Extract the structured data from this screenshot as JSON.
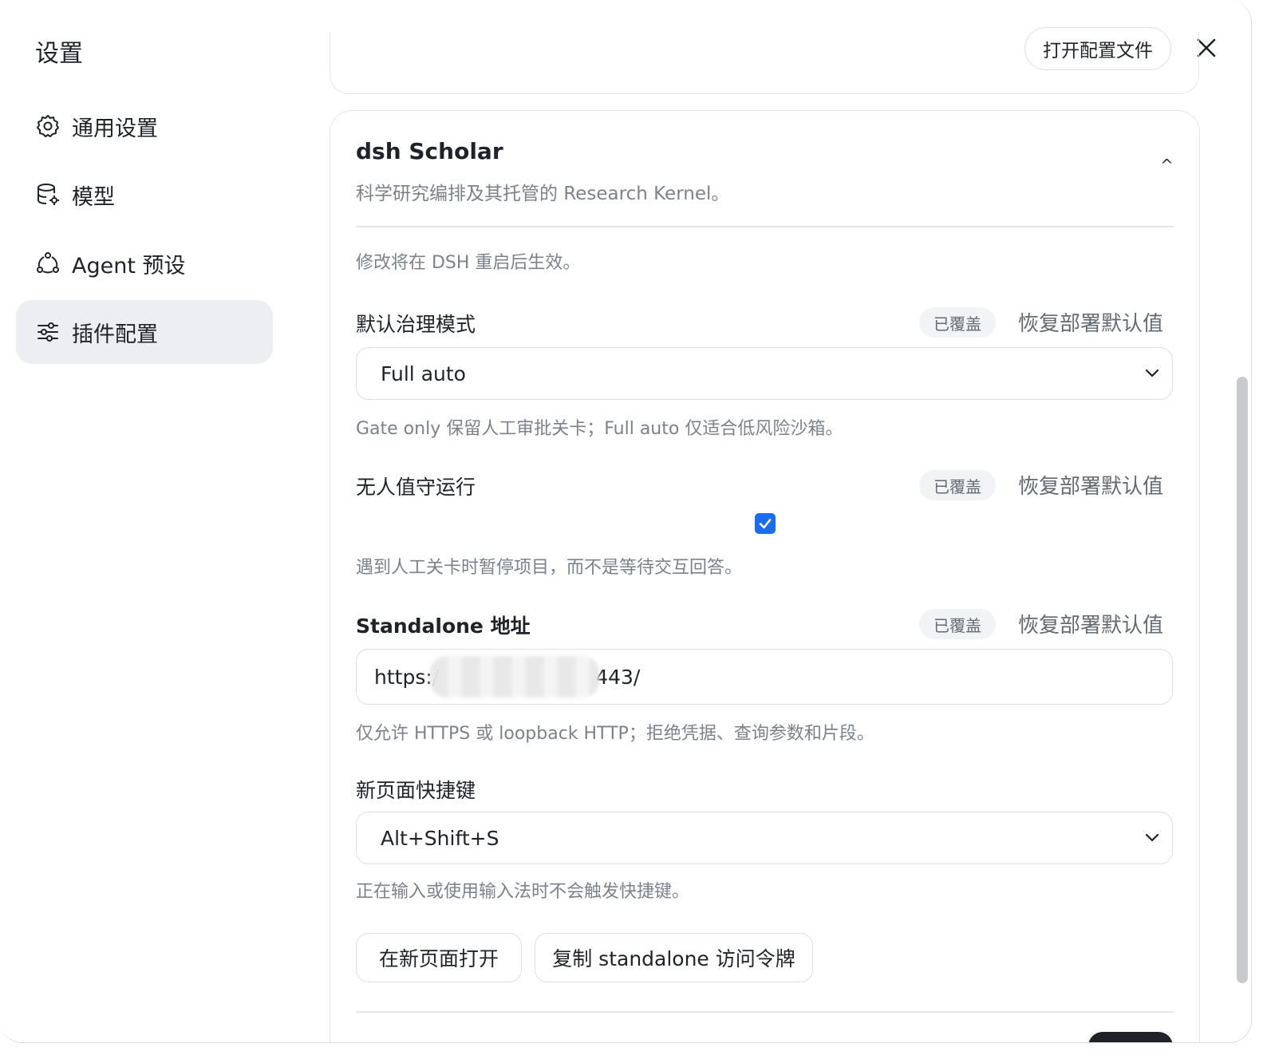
{
  "dialog": {
    "title": "设置",
    "open_config_label": "打开配置文件"
  },
  "sidebar": {
    "items": [
      {
        "label": "通用设置",
        "icon": "gear-icon"
      },
      {
        "label": "模型",
        "icon": "database-gear-icon"
      },
      {
        "label": "Agent 预设",
        "icon": "agent-icon"
      },
      {
        "label": "插件配置",
        "icon": "sliders-icon",
        "active": true
      }
    ]
  },
  "plugin": {
    "title": "dsh Scholar",
    "description": "科学研究编排及其托管的 Research Kernel。",
    "collapse_glyph": "^",
    "restart_notice": "修改将在 DSH 重启后生效。"
  },
  "fields": {
    "governance": {
      "label": "默认治理模式",
      "badge": "已覆盖",
      "reset": "恢复部署默认值",
      "value": "Full auto",
      "hint": "Gate only 保留人工审批关卡；Full auto 仅适合低风险沙箱。"
    },
    "unattended": {
      "label": "无人值守运行",
      "badge": "已覆盖",
      "reset": "恢复部署默认值",
      "checked": true,
      "hint": "遇到人工关卡时暂停项目，而不是等待交互回答。"
    },
    "standalone": {
      "label": "Standalone 地址",
      "badge": "已覆盖",
      "reset": "恢复部署默认值",
      "value_prefix": "https:/",
      "value_suffix": "443/",
      "hint": "仅允许 HTTPS 或 loopback HTTP；拒绝凭据、查询参数和片段。"
    },
    "shortcut": {
      "label": "新页面快捷键",
      "value": "Alt+Shift+S",
      "hint": "正在输入或使用输入法时不会触发快捷键。"
    }
  },
  "actions": {
    "open_new_page": "在新页面打开",
    "copy_token": "复制 standalone 访问令牌"
  },
  "colors": {
    "accent": "#1a6cf0",
    "active_nav_bg": "#eceef2",
    "muted_text": "#7c828c"
  }
}
